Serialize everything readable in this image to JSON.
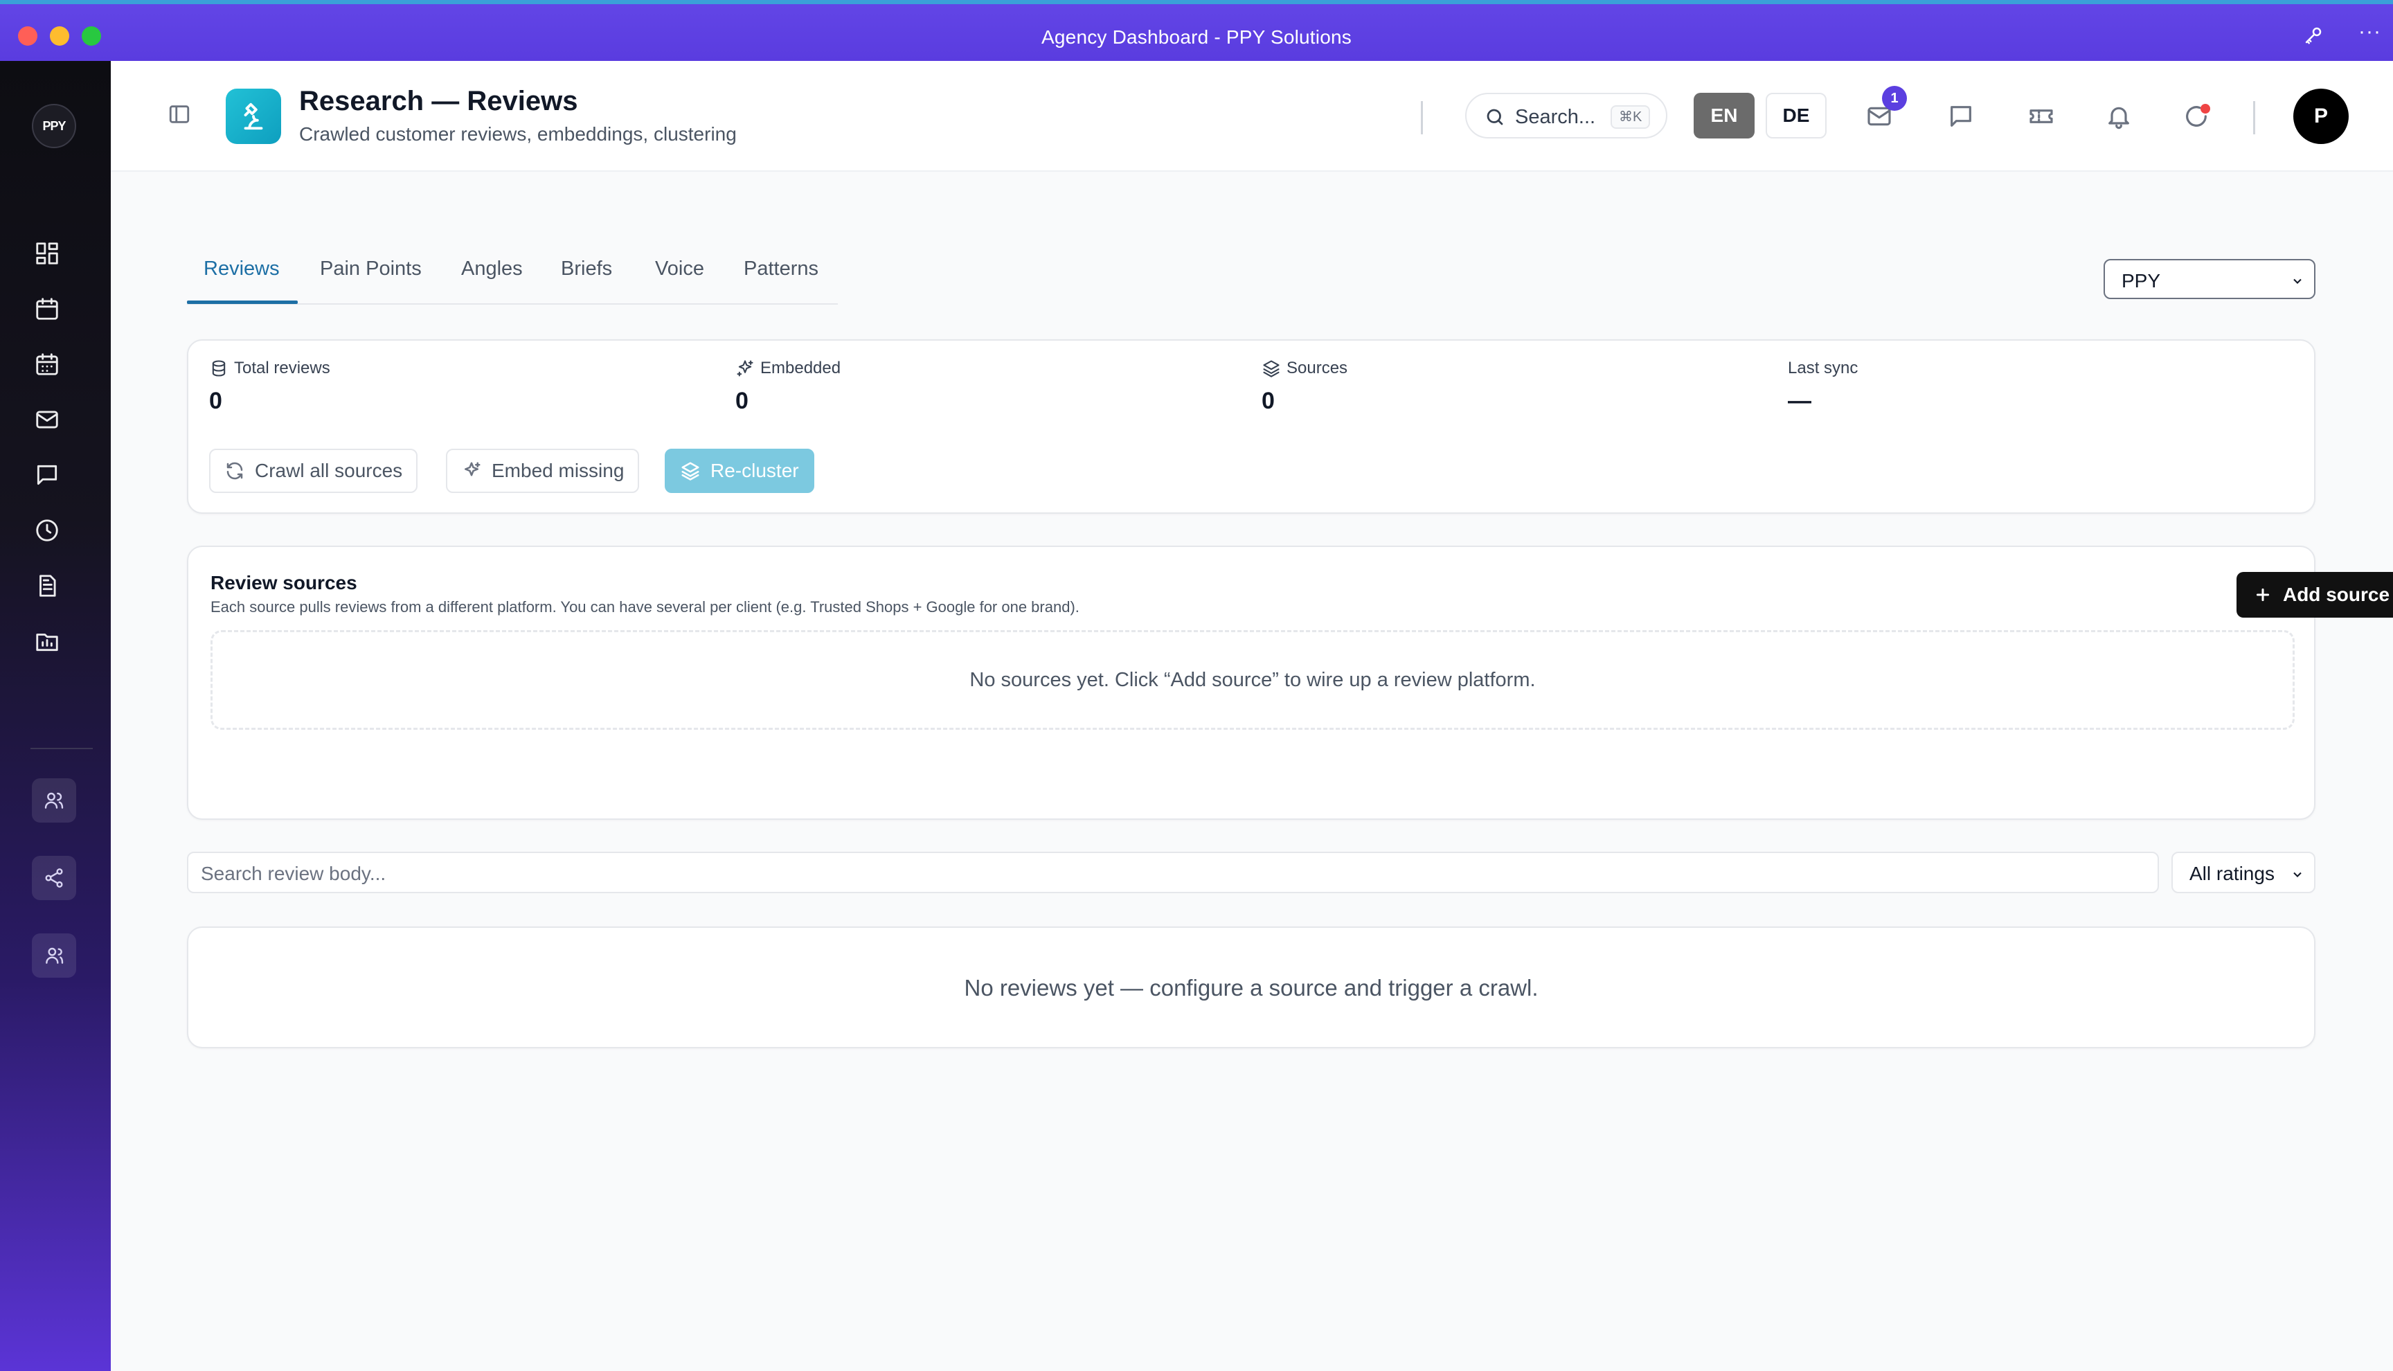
{
  "window": {
    "title": "Agency Dashboard - PPY Solutions"
  },
  "sidebar": {
    "logo_text": "PPY",
    "items": [
      {
        "icon": "dashboard-icon"
      },
      {
        "icon": "calendar-icon"
      },
      {
        "icon": "calendar-grid-icon"
      },
      {
        "icon": "mail-icon"
      },
      {
        "icon": "message-icon"
      },
      {
        "icon": "clock-icon"
      },
      {
        "icon": "document-icon"
      },
      {
        "icon": "folder-chart-icon"
      }
    ],
    "secondary": [
      {
        "icon": "users-icon"
      },
      {
        "icon": "share-icon"
      },
      {
        "icon": "user-group-icon"
      }
    ]
  },
  "header": {
    "title": "Research — Reviews",
    "subtitle": "Crawled customer reviews, embeddings, clustering",
    "search_label": "Search...",
    "search_shortcut": "⌘K",
    "lang_en": "EN",
    "lang_de": "DE",
    "mail_badge": "1",
    "avatar_initial": "P"
  },
  "tabs": [
    {
      "label": "Reviews",
      "active": true
    },
    {
      "label": "Pain Points"
    },
    {
      "label": "Angles"
    },
    {
      "label": "Briefs"
    },
    {
      "label": "Voice"
    },
    {
      "label": "Patterns"
    }
  ],
  "client_select": {
    "value": "PPY"
  },
  "stats": {
    "total_reviews": {
      "label": "Total reviews",
      "value": "0"
    },
    "embedded": {
      "label": "Embedded",
      "value": "0"
    },
    "sources": {
      "label": "Sources",
      "value": "0"
    },
    "last_sync": {
      "label": "Last sync",
      "value": "—"
    }
  },
  "actions": {
    "crawl": "Crawl all sources",
    "embed": "Embed missing",
    "recluster": "Re-cluster"
  },
  "review_sources": {
    "title": "Review sources",
    "description": "Each source pulls reviews from a different platform. You can have several per client (e.g. Trusted Shops + Google for one brand).",
    "add_button": "Add source",
    "empty": "No sources yet. Click “Add source” to wire up a review platform."
  },
  "filters": {
    "search_placeholder": "Search review body...",
    "rating_value": "All ratings"
  },
  "reviews": {
    "empty": "No reviews yet — configure a source and trigger a crawl."
  },
  "colors": {
    "accent": "#5b3fe0",
    "tab_active": "#1d6fa5",
    "page_icon": "#16b0cc",
    "primary_light": "#7cc9e0"
  }
}
